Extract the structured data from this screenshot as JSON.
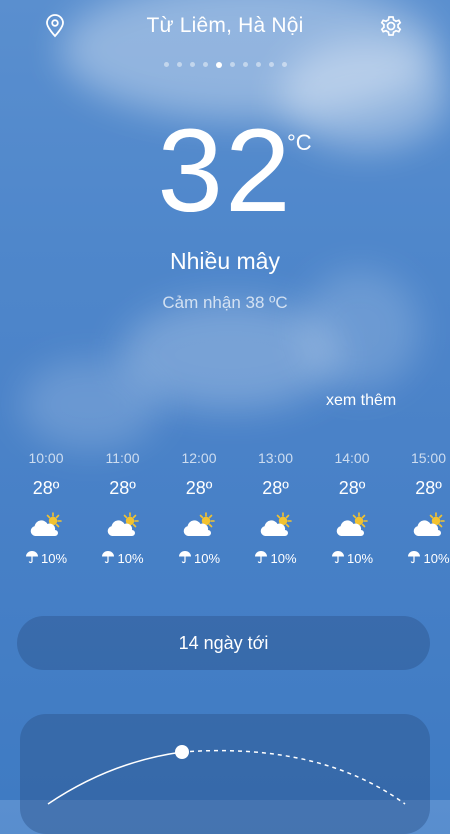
{
  "header": {
    "location": "Từ Liêm, Hà Nội",
    "left_icon": "location-pin-icon",
    "right_icon": "gear-icon"
  },
  "pager": {
    "count": 10,
    "active_index": 4
  },
  "current": {
    "temperature": "32",
    "unit": "°C",
    "condition": "Nhiều mây",
    "feels_like": "Cảm nhận 38 ºC"
  },
  "hourly": {
    "more_label": "xem thêm",
    "items": [
      {
        "time": "10:00",
        "temp": "28º",
        "icon": "partly-cloudy-icon",
        "rain": "10%"
      },
      {
        "time": "11:00",
        "temp": "28º",
        "icon": "partly-cloudy-icon",
        "rain": "10%"
      },
      {
        "time": "12:00",
        "temp": "28º",
        "icon": "partly-cloudy-icon",
        "rain": "10%"
      },
      {
        "time": "13:00",
        "temp": "28º",
        "icon": "partly-cloudy-icon",
        "rain": "10%"
      },
      {
        "time": "14:00",
        "temp": "28º",
        "icon": "partly-cloudy-icon",
        "rain": "10%"
      },
      {
        "time": "15:00",
        "temp": "28º",
        "icon": "partly-cloudy-icon",
        "rain": "10%"
      }
    ]
  },
  "forecast_button": {
    "label": "14 ngày tới"
  },
  "colors": {
    "sun": "#f2c230",
    "panel": "#3a6aa8",
    "sky": "#4a82c8"
  }
}
